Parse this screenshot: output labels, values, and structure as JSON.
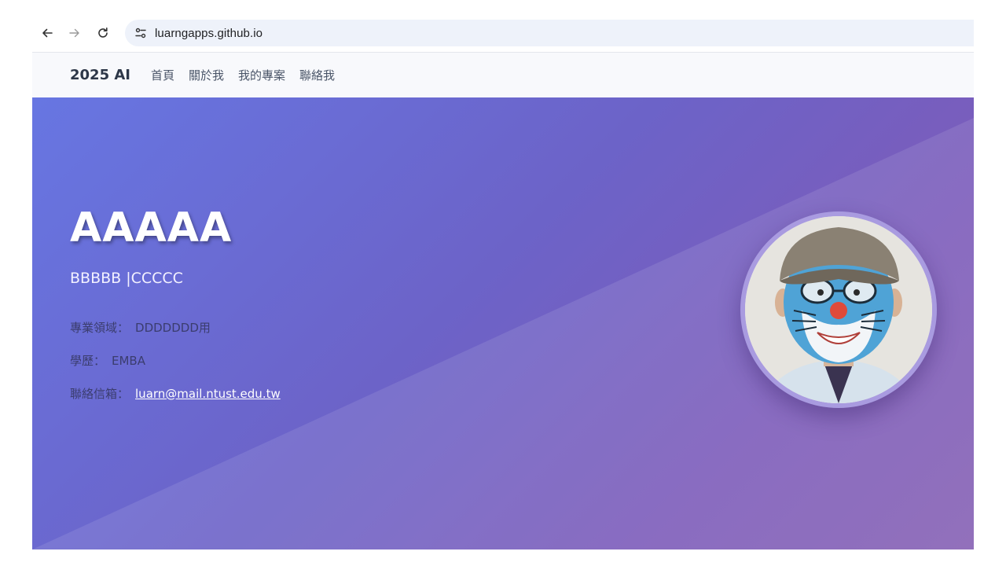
{
  "browser": {
    "url": "luarngapps.github.io"
  },
  "navbar": {
    "brand": "2025 AI",
    "links": [
      "首頁",
      "關於我",
      "我的專案",
      "聯絡我"
    ]
  },
  "hero": {
    "title": "AAAAA",
    "subtitle": "BBBBB |CCCCC",
    "field_label": "專業領域：",
    "field_value": "DDDDDDD用",
    "education_label": "學歷：",
    "education_value": "EMBA",
    "email_label": "聯絡信箱：",
    "email_value": "luarn@mail.ntust.edu.tw"
  },
  "colors": {
    "hero_gradient_start": "#6776e2",
    "hero_gradient_end": "#8660b4",
    "avatar_ring": "#a99be0"
  },
  "icons": {
    "back": "arrow-left-icon",
    "forward": "arrow-right-icon",
    "reload": "reload-icon",
    "site_info": "tune-icon"
  }
}
